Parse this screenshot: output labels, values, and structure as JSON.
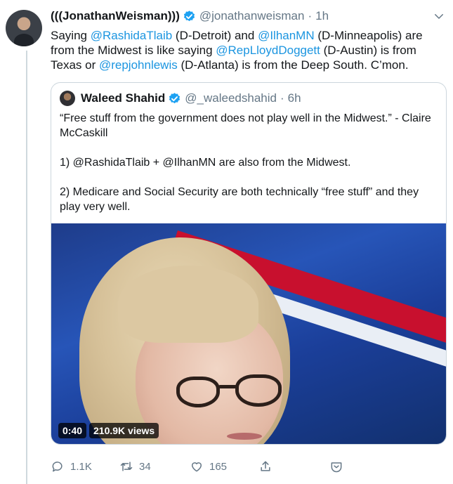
{
  "tweet": {
    "author_name": "(((JonathanWeisman)))",
    "handle": "@jonathanweisman",
    "separator": "·",
    "time": "1h",
    "text": {
      "t1": "Saying ",
      "m1": "@RashidaTlaib",
      "t2": " (D-Detroit) and ",
      "m2": "@IlhanMN",
      "t3": " (D-Minneapolis) are from the Midwest is like saying ",
      "m3": "@RepLloydDoggett",
      "t4": " (D-Austin) is from Texas or ",
      "m4": "@repjohnlewis",
      "t5": " (D-Atlanta) is from the Deep South. C’mon."
    }
  },
  "quoted": {
    "author_name": "Waleed Shahid",
    "handle": "@_waleedshahid",
    "separator": "·",
    "time": "6h",
    "paragraphs": [
      "“Free stuff from the government does not play well in the Midwest.” - Claire McCaskill",
      "1) @RashidaTlaib + @IlhanMN are also from the Midwest.",
      "2) Medicare and Social Security are both technically “free stuff” and they play very well."
    ],
    "video": {
      "duration": "0:40",
      "views": "210.9K views"
    }
  },
  "actions": {
    "reply_count": "1.1K",
    "retweet_count": "34",
    "like_count": "165"
  },
  "icons": {
    "verified": "verified-badge-icon",
    "chevron": "chevron-down-icon",
    "reply": "reply-icon",
    "retweet": "retweet-icon",
    "like": "heart-icon",
    "share": "share-icon",
    "analytics": "tweet-activity-icon"
  },
  "colors": {
    "accent": "#1b95e0",
    "secondary_text": "#657786",
    "border": "#ccd6dd"
  }
}
